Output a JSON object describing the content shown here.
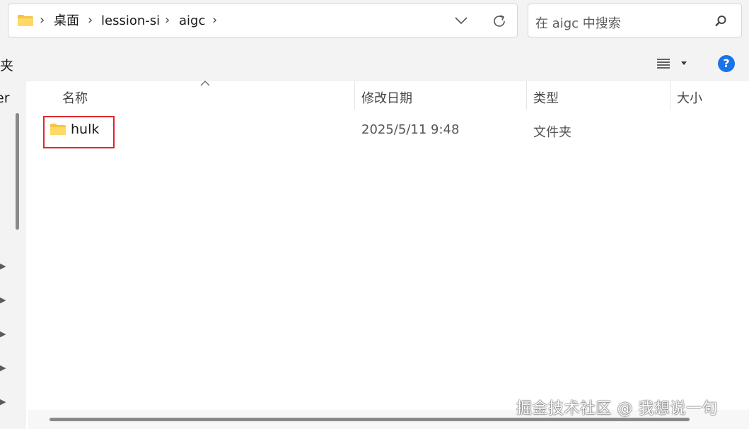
{
  "address_bar": {
    "breadcrumbs": [
      "桌面",
      "lession-si",
      "aigc"
    ],
    "separator": "›"
  },
  "search": {
    "placeholder": "在 aigc 中搜索"
  },
  "toolbar": {
    "left_label": "夹",
    "help_label": "?"
  },
  "nav_pane": {
    "partial_label": "er"
  },
  "columns": {
    "name": "名称",
    "modified": "修改日期",
    "type": "类型",
    "size": "大小"
  },
  "files": [
    {
      "name": "hulk",
      "modified": "2025/5/11 9:48",
      "type": "文件夹",
      "size": ""
    }
  ],
  "highlight_color": "#e0262b",
  "accent_color": "#1a73e8",
  "watermark": "掘金技术社区 @ 我想说一句"
}
